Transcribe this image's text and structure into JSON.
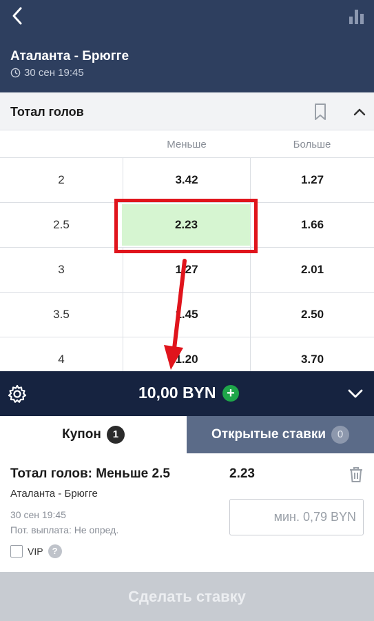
{
  "header": {
    "match_title": "Аталанта - Брюгге",
    "match_time": "30 сен 19:45"
  },
  "market": {
    "title": "Тотал голов",
    "col_under": "Меньше",
    "col_over": "Больше",
    "rows": [
      {
        "line": "2",
        "under": "3.42",
        "over": "1.27"
      },
      {
        "line": "2.5",
        "under": "2.23",
        "over": "1.66"
      },
      {
        "line": "3",
        "under": "1.27",
        "over": "2.01"
      },
      {
        "line": "3.5",
        "under": "1.45",
        "over": "2.50"
      },
      {
        "line": "4",
        "under": "1.20",
        "over": "3.70"
      }
    ]
  },
  "betbar": {
    "stake": "10,00 BYN",
    "plus": "+"
  },
  "tabs": {
    "coupon_label": "Купон",
    "coupon_count": "1",
    "open_label": "Открытые ставки",
    "open_count": "0"
  },
  "coupon": {
    "bet_title": "Тотал голов: Меньше 2.5",
    "odds": "2.23",
    "match": "Аталанта - Брюгге",
    "time": "30 сен 19:45",
    "payout": "Пот. выплата: Не опред.",
    "input_placeholder": "мин. 0,79 BYN",
    "vip_label": "VIP",
    "help": "?"
  },
  "submit_label": "Сделать ставку",
  "colors": {
    "header_bg": "#2e3f5f",
    "betbar_bg": "#162340",
    "selected_cell": "#d6f5d1",
    "annotation_red": "#e0141c",
    "plus_green": "#1fa64a"
  }
}
